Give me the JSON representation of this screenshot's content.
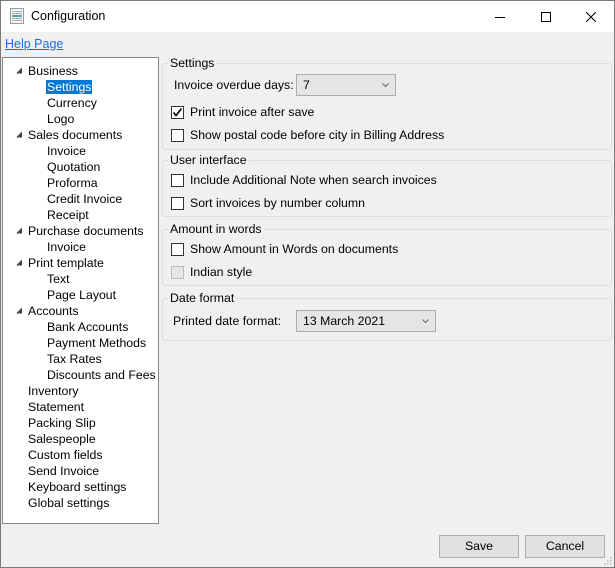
{
  "window": {
    "title": "Configuration",
    "icon": "document-icon",
    "controls": [
      "minimize",
      "maximize",
      "close"
    ]
  },
  "help_link": "Help Page",
  "tree": {
    "selected": "Settings",
    "items": [
      {
        "label": "Business",
        "level": 0,
        "expanded": true
      },
      {
        "label": "Settings",
        "level": 1,
        "selected": true
      },
      {
        "label": "Currency",
        "level": 1
      },
      {
        "label": "Logo",
        "level": 1
      },
      {
        "label": "Sales documents",
        "level": 0,
        "expanded": true
      },
      {
        "label": "Invoice",
        "level": 1
      },
      {
        "label": "Quotation",
        "level": 1
      },
      {
        "label": "Proforma",
        "level": 1
      },
      {
        "label": "Credit Invoice",
        "level": 1
      },
      {
        "label": "Receipt",
        "level": 1
      },
      {
        "label": "Purchase documents",
        "level": 0,
        "expanded": true
      },
      {
        "label": "Invoice",
        "level": 1
      },
      {
        "label": "Print template",
        "level": 0,
        "expanded": true
      },
      {
        "label": "Text",
        "level": 1
      },
      {
        "label": "Page Layout",
        "level": 1
      },
      {
        "label": "Accounts",
        "level": 0,
        "expanded": true
      },
      {
        "label": "Bank Accounts",
        "level": 1
      },
      {
        "label": "Payment Methods",
        "level": 1
      },
      {
        "label": "Tax Rates",
        "level": 1
      },
      {
        "label": "Discounts and Fees",
        "level": 1
      },
      {
        "label": "Inventory",
        "level": 0
      },
      {
        "label": "Statement",
        "level": 0
      },
      {
        "label": "Packing Slip",
        "level": 0
      },
      {
        "label": "Salespeople",
        "level": 0
      },
      {
        "label": "Custom fields",
        "level": 0
      },
      {
        "label": "Send Invoice",
        "level": 0
      },
      {
        "label": "Keyboard settings",
        "level": 0
      },
      {
        "label": "Global settings",
        "level": 0
      }
    ]
  },
  "settings_group": {
    "title": "Settings",
    "overdue_label": "Invoice overdue days:",
    "overdue_value": "7",
    "print_after_save": {
      "label": "Print invoice after save",
      "checked": true
    },
    "postal_before_city": {
      "label": "Show postal code before city in Billing Address",
      "checked": false
    }
  },
  "ui_group": {
    "title": "User interface",
    "include_note": {
      "label": "Include Additional Note when search invoices",
      "checked": false
    },
    "sort_by_number": {
      "label": "Sort invoices by number column",
      "checked": false
    }
  },
  "words_group": {
    "title": "Amount in words",
    "show_words": {
      "label": "Show Amount in Words on documents",
      "checked": false
    },
    "indian_style": {
      "label": "Indian style",
      "checked": false,
      "disabled": true
    }
  },
  "date_group": {
    "title": "Date format",
    "printed_label": "Printed date format:",
    "printed_value": "13 March 2021"
  },
  "buttons": {
    "save": "Save",
    "cancel": "Cancel"
  },
  "colors": {
    "selection": "#0078d7",
    "link": "#1a6fd6"
  }
}
